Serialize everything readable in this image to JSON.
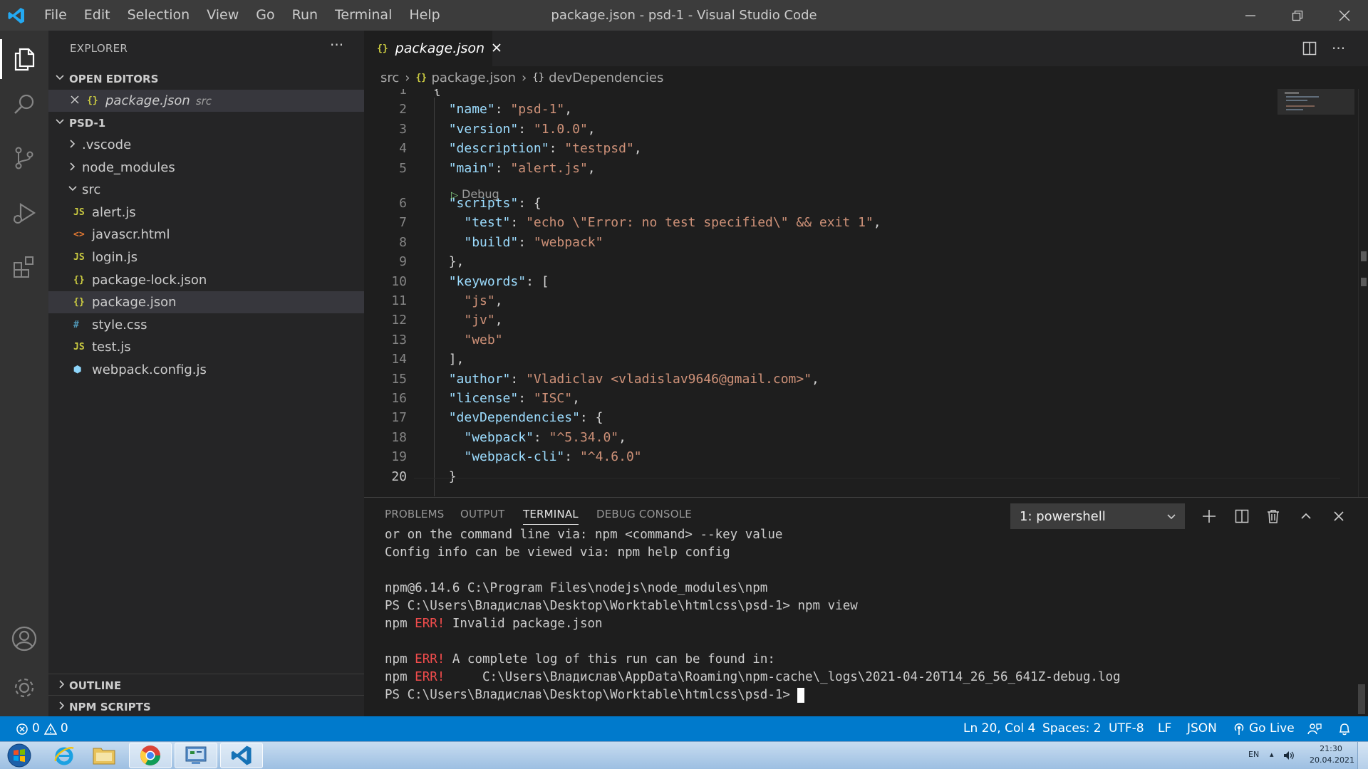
{
  "titlebar": {
    "title": "package.json - psd-1 - Visual Studio Code",
    "menu": [
      "File",
      "Edit",
      "Selection",
      "View",
      "Go",
      "Run",
      "Terminal",
      "Help"
    ]
  },
  "sidebar": {
    "header": "EXPLORER",
    "open_editors_title": "OPEN EDITORS",
    "open_editor": {
      "name": "package.json",
      "folder": "src"
    },
    "project_title": "PSD-1",
    "tree": [
      {
        "name": ".vscode",
        "kind": "folder-collapsed"
      },
      {
        "name": "node_modules",
        "kind": "folder-collapsed"
      },
      {
        "name": "src",
        "kind": "folder-expanded"
      },
      {
        "name": "alert.js",
        "kind": "js"
      },
      {
        "name": "javascr.html",
        "kind": "html"
      },
      {
        "name": "login.js",
        "kind": "js"
      },
      {
        "name": "package-lock.json",
        "kind": "json"
      },
      {
        "name": "package.json",
        "kind": "json"
      },
      {
        "name": "style.css",
        "kind": "css"
      },
      {
        "name": "test.js",
        "kind": "js"
      },
      {
        "name": "webpack.config.js",
        "kind": "webpack"
      }
    ],
    "outline_title": "OUTLINE",
    "npm_scripts_title": "NPM SCRIPTS"
  },
  "editor": {
    "tab_label": "package.json",
    "breadcrumb": [
      "src",
      "package.json",
      "devDependencies"
    ],
    "codelens": "Debug",
    "active_line": 20
  },
  "code_lines": [
    {
      "n": "1",
      "t": "{"
    },
    {
      "n": "2",
      "t": "  \"name\": \"psd-1\","
    },
    {
      "n": "3",
      "t": "  \"version\": \"1.0.0\","
    },
    {
      "n": "4",
      "t": "  \"description\": \"testpsd\","
    },
    {
      "n": "5",
      "t": "  \"main\": \"alert.js\","
    },
    {
      "n": "6",
      "t": "  \"scripts\": {"
    },
    {
      "n": "7",
      "t": "    \"test\": \"echo \\\"Error: no test specified\\\" && exit 1\","
    },
    {
      "n": "8",
      "t": "    \"build\": \"webpack\""
    },
    {
      "n": "9",
      "t": "  },"
    },
    {
      "n": "10",
      "t": "  \"keywords\": ["
    },
    {
      "n": "11",
      "t": "    \"js\","
    },
    {
      "n": "12",
      "t": "    \"jv\","
    },
    {
      "n": "13",
      "t": "    \"web\""
    },
    {
      "n": "14",
      "t": "  ],"
    },
    {
      "n": "15",
      "t": "  \"author\": \"Vladiclav <vladislav9646@gmail.com>\","
    },
    {
      "n": "16",
      "t": "  \"license\": \"ISC\","
    },
    {
      "n": "17",
      "t": "  \"devDependencies\": {"
    },
    {
      "n": "18",
      "t": "    \"webpack\": \"^5.34.0\","
    },
    {
      "n": "19",
      "t": "    \"webpack-cli\": \"^4.6.0\""
    },
    {
      "n": "20",
      "t": "  }"
    }
  ],
  "panel": {
    "tabs": [
      "PROBLEMS",
      "OUTPUT",
      "TERMINAL",
      "DEBUG CONSOLE"
    ],
    "active_tab": "TERMINAL",
    "terminal_select": "1: powershell",
    "lines": [
      "or on the command line via: npm <command> --key value",
      "Config info can be viewed via: npm help config",
      "",
      "npm@6.14.6 C:\\Program Files\\nodejs\\node_modules\\npm",
      "PS C:\\Users\\Владислав\\Desktop\\Worktable\\htmlcss\\psd-1> npm view",
      "npm ERR! Invalid package.json",
      "",
      "npm ERR! A complete log of this run can be found in:",
      "npm ERR!     C:\\Users\\Владислав\\AppData\\Roaming\\npm-cache\\_logs\\2021-04-20T14_26_56_641Z-debug.log",
      "PS C:\\Users\\Владислав\\Desktop\\Worktable\\htmlcss\\psd-1> "
    ]
  },
  "statusbar": {
    "errors": "0",
    "warnings": "0",
    "position": "Ln 20, Col 4",
    "spaces": "Spaces: 2",
    "encoding": "UTF-8",
    "eol": "LF",
    "language": "JSON",
    "golive": "Go Live"
  },
  "taskbar": {
    "lang": "EN",
    "time": "21:30",
    "date": "20.04.2021"
  },
  "colors": {
    "accent": "#007acc",
    "key": "#9cdcfe",
    "string": "#ce9178",
    "error": "#f14c4c",
    "json_icon": "#cbcb41",
    "js_icon": "#cbcb41",
    "html_icon": "#e37933",
    "css_icon": "#519aba"
  }
}
